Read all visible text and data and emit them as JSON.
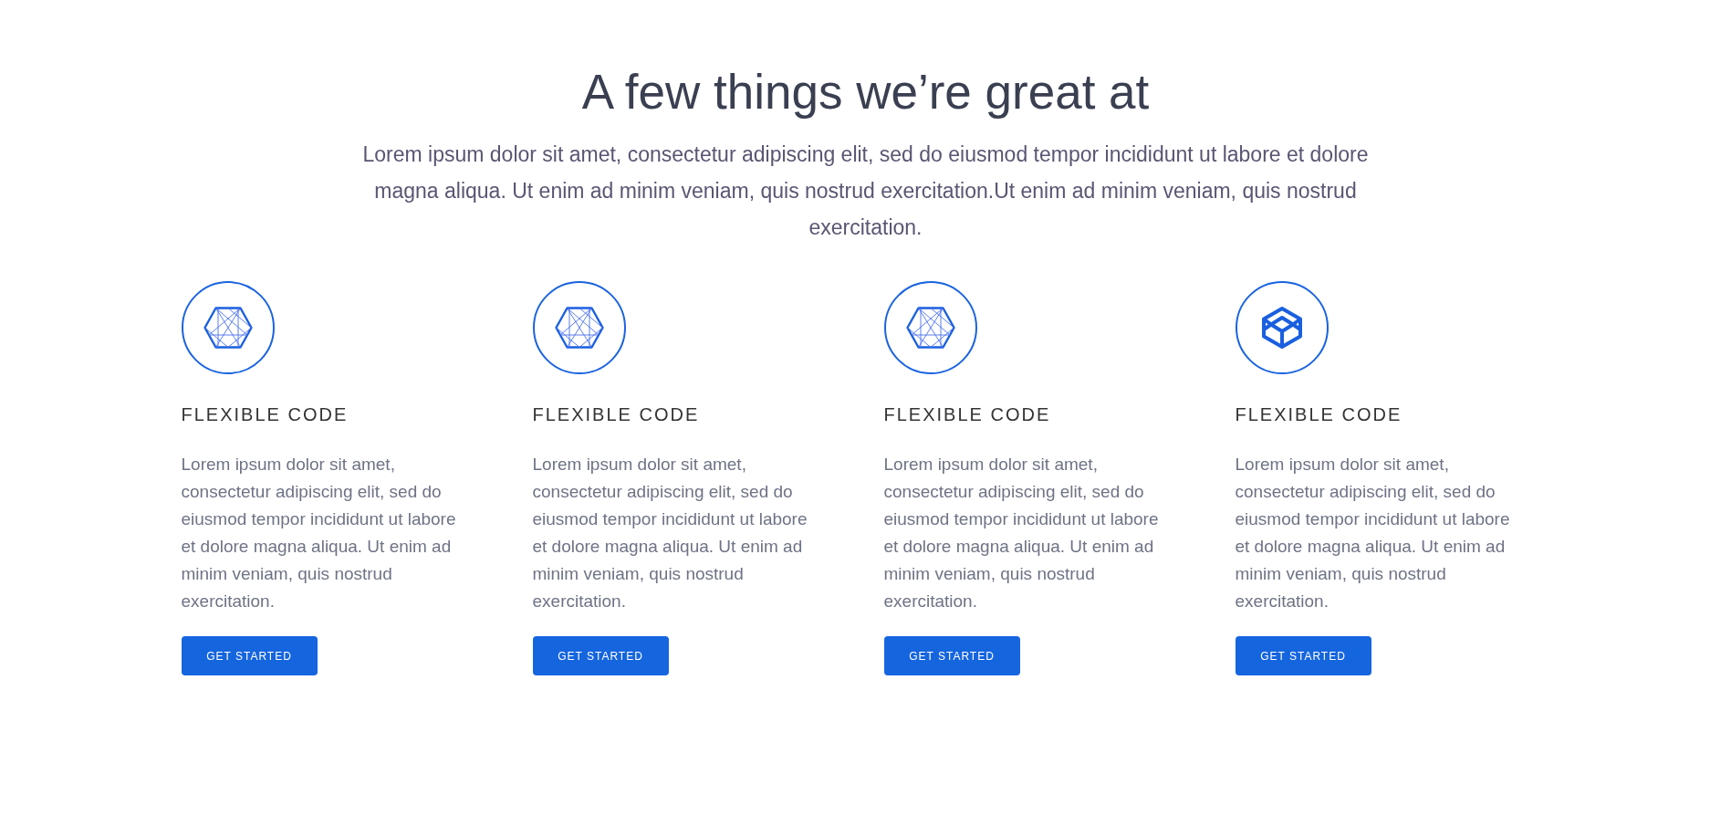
{
  "heading": "A few things we’re great at",
  "intro": "Lorem ipsum dolor sit amet, consectetur adipiscing elit, sed do eiusmod tempor incididunt ut labore et dolore magna aliqua. Ut enim ad minim veniam, quis nostrud exercitation.Ut enim ad minim veniam, quis nostrud exercitation.",
  "features": [
    {
      "kind": "wireframe",
      "title": "FLEXIBLE CODE",
      "text": "Lorem ipsum dolor sit amet, consectetur adipiscing elit, sed do eiusmod tempor incididunt ut labore et dolore magna aliqua. Ut enim ad minim veniam, quis nostrud exercitation.",
      "button": "GET STARTED"
    },
    {
      "kind": "wireframe",
      "title": "FLEXIBLE CODE",
      "text": "Lorem ipsum dolor sit amet, consectetur adipiscing elit, sed do eiusmod tempor incididunt ut labore et dolore magna aliqua. Ut enim ad minim veniam, quis nostrud exercitation.",
      "button": "GET STARTED"
    },
    {
      "kind": "wireframe",
      "title": "FLEXIBLE CODE",
      "text": "Lorem ipsum dolor sit amet, consectetur adipiscing elit, sed do eiusmod tempor incididunt ut labore et dolore magna aliqua. Ut enim ad minim veniam, quis nostrud exercitation.",
      "button": "GET STARTED"
    },
    {
      "kind": "cube",
      "title": "FLEXIBLE CODE",
      "text": "Lorem ipsum dolor sit amet, consectetur adipiscing elit, sed do eiusmod tempor incididunt ut labore et dolore magna aliqua. Ut enim ad minim veniam, quis nostrud exercitation.",
      "button": "GET STARTED"
    }
  ]
}
